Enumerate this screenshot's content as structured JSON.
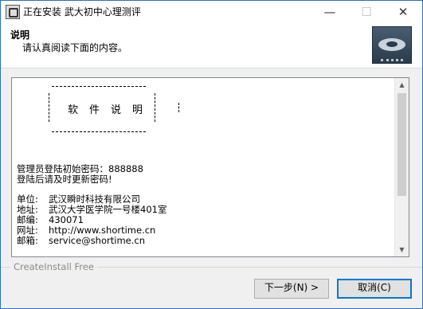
{
  "window": {
    "title": "正在安装 武大初中心理测评",
    "minimize_glyph": "—",
    "maximize_glyph": "☐",
    "close_glyph": "✕"
  },
  "header": {
    "title": "说明",
    "subtitle": "请认真阅读下面的内容。",
    "logo_icon": "cd-disc-icon"
  },
  "content": {
    "box_title": "软件说明",
    "password_line": "管理员登陆初始密码：888888",
    "reminder_line": "登陆后请及时更新密码!",
    "fields": [
      {
        "label": "单位:",
        "value": "武汉瞬时科技有限公司"
      },
      {
        "label": "地址:",
        "value": "武汉大学医学院一号楼401室"
      },
      {
        "label": "邮编:",
        "value": "430071"
      },
      {
        "label": "网址:",
        "value": "http://www.shortime.cn"
      },
      {
        "label": "邮箱:",
        "value": "service@shortime.cn"
      }
    ]
  },
  "footer": {
    "brand": "CreateInstall Free",
    "next_label": "下一步(N) >",
    "cancel_label": "取消(C)"
  },
  "colors": {
    "accent": "#0078d7",
    "window_border": "#2b6ec4",
    "background": "#f0f0f0"
  }
}
